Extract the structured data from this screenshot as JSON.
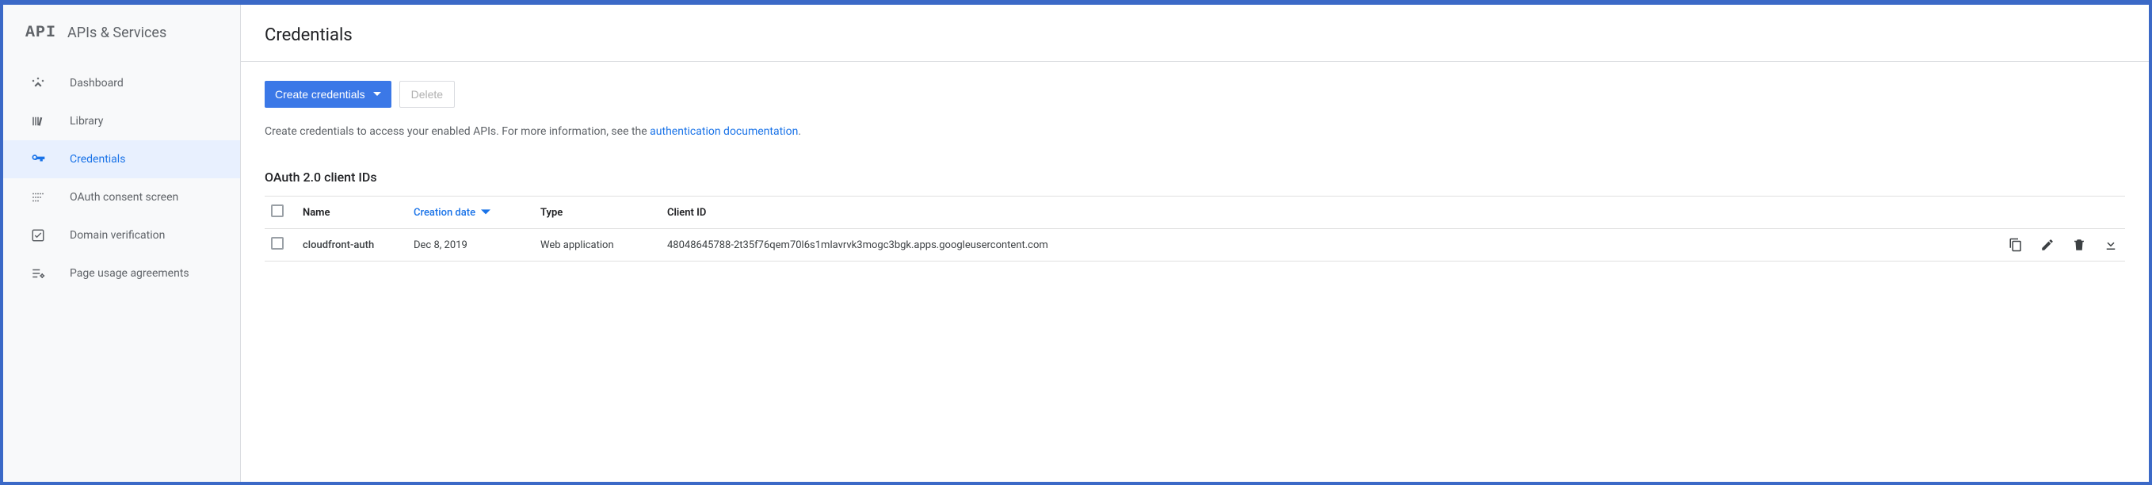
{
  "sidebar": {
    "logo": "API",
    "title": "APIs & Services",
    "items": [
      {
        "label": "Dashboard",
        "icon": "dashboard"
      },
      {
        "label": "Library",
        "icon": "library"
      },
      {
        "label": "Credentials",
        "icon": "key",
        "active": true
      },
      {
        "label": "OAuth consent screen",
        "icon": "consent"
      },
      {
        "label": "Domain verification",
        "icon": "verified"
      },
      {
        "label": "Page usage agreements",
        "icon": "agreements"
      }
    ]
  },
  "header": {
    "title": "Credentials"
  },
  "actions": {
    "create_label": "Create credentials",
    "delete_label": "Delete"
  },
  "help": {
    "prefix": "Create credentials to access your enabled APIs. For more information, see the ",
    "link_text": "authentication documentation",
    "suffix": "."
  },
  "section": {
    "title": "OAuth 2.0 client IDs"
  },
  "table": {
    "headers": {
      "name": "Name",
      "creation_date": "Creation date",
      "type": "Type",
      "client_id": "Client ID"
    },
    "rows": [
      {
        "name": "cloudfront-auth",
        "creation_date": "Dec 8, 2019",
        "type": "Web application",
        "client_id": "48048645788-2t35f76qem70l6s1mlavrvk3mogc3bgk.apps.googleusercontent.com"
      }
    ]
  }
}
